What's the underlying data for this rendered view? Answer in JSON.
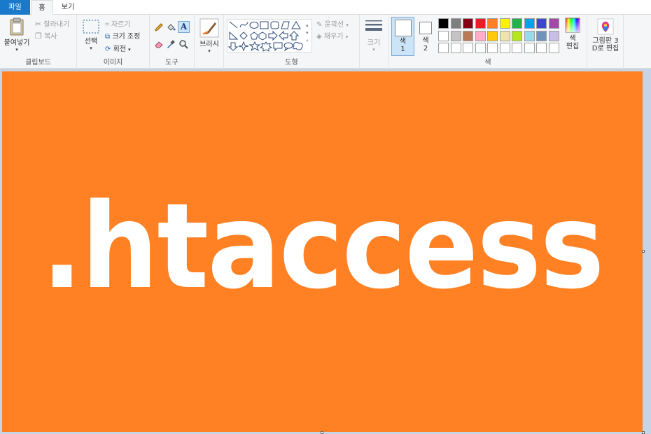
{
  "tabs": {
    "file": "파일",
    "home": "홈",
    "view": "보기"
  },
  "clipboard": {
    "paste": "붙여넣기",
    "cut": "잘라내기",
    "copy": "복사",
    "label": "클립보드"
  },
  "image": {
    "select": "선택",
    "crop": "자르기",
    "resize": "크기 조정",
    "rotate": "회전",
    "label": "이미지"
  },
  "tools": {
    "label": "도구"
  },
  "brushes": {
    "label": "브러시"
  },
  "shapes": {
    "outline": "윤곽선",
    "fill": "채우기",
    "label": "도형"
  },
  "size": {
    "label": "크기"
  },
  "colors": {
    "color1": "색\n1",
    "color1_a": "색",
    "color1_b": "1",
    "color2_a": "색",
    "color2_b": "2",
    "edit_a": "색",
    "edit_b": "편집",
    "label": "색",
    "row1": [
      "#000000",
      "#7f7f7f",
      "#880015",
      "#ed1c24",
      "#ff7f27",
      "#fff200",
      "#22b14c",
      "#00a2e8",
      "#3f48cc",
      "#a349a4"
    ],
    "row2": [
      "#ffffff",
      "#c3c3c3",
      "#b97a57",
      "#ffaec9",
      "#ffc90e",
      "#efe4b0",
      "#b5e61d",
      "#99d9ea",
      "#7092be",
      "#c8bfe7"
    ]
  },
  "paint3d": {
    "line1": "그림판 3",
    "line2": "D로 편집"
  },
  "canvas": {
    "text": ".htaccess",
    "background": "#ff8124"
  }
}
